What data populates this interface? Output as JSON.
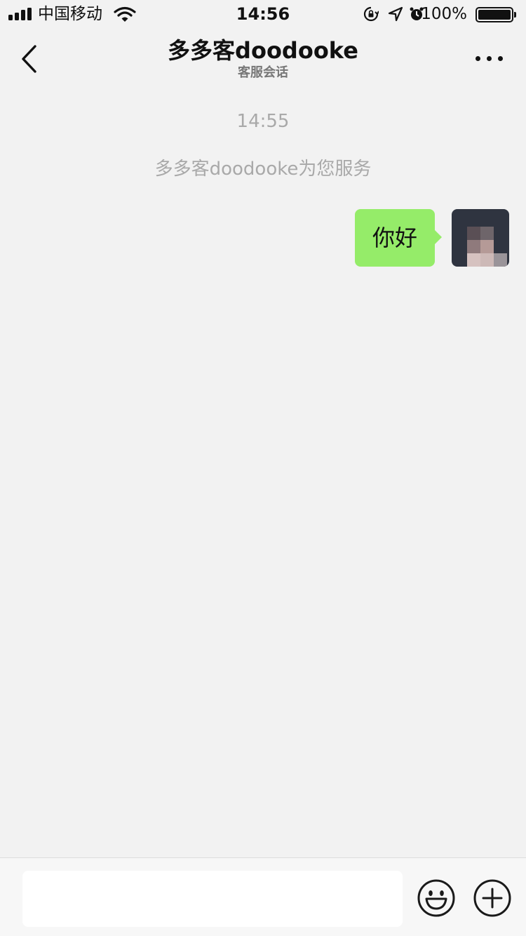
{
  "status_bar": {
    "carrier": "中国移动",
    "time": "14:56",
    "battery_percent": "100%",
    "icons": [
      "signal-icon",
      "wifi-icon",
      "orientation-lock-icon",
      "location-icon",
      "alarm-icon",
      "battery-icon"
    ]
  },
  "nav": {
    "title": "多多客doodooke",
    "subtitle": "客服会话",
    "icons": [
      "back-chevron-icon",
      "more-dots-icon"
    ]
  },
  "chat": {
    "timestamp": "14:55",
    "system_message": "多多客doodooke为您服务",
    "messages": [
      {
        "direction": "outgoing",
        "text": "你好"
      }
    ]
  },
  "input_bar": {
    "placeholder": "",
    "icons": [
      "emoji-icon",
      "add-icon"
    ]
  },
  "colors": {
    "background": "#f2f2f2",
    "bubble_outgoing": "#95ec69",
    "meta_text": "#a9a9a9"
  }
}
